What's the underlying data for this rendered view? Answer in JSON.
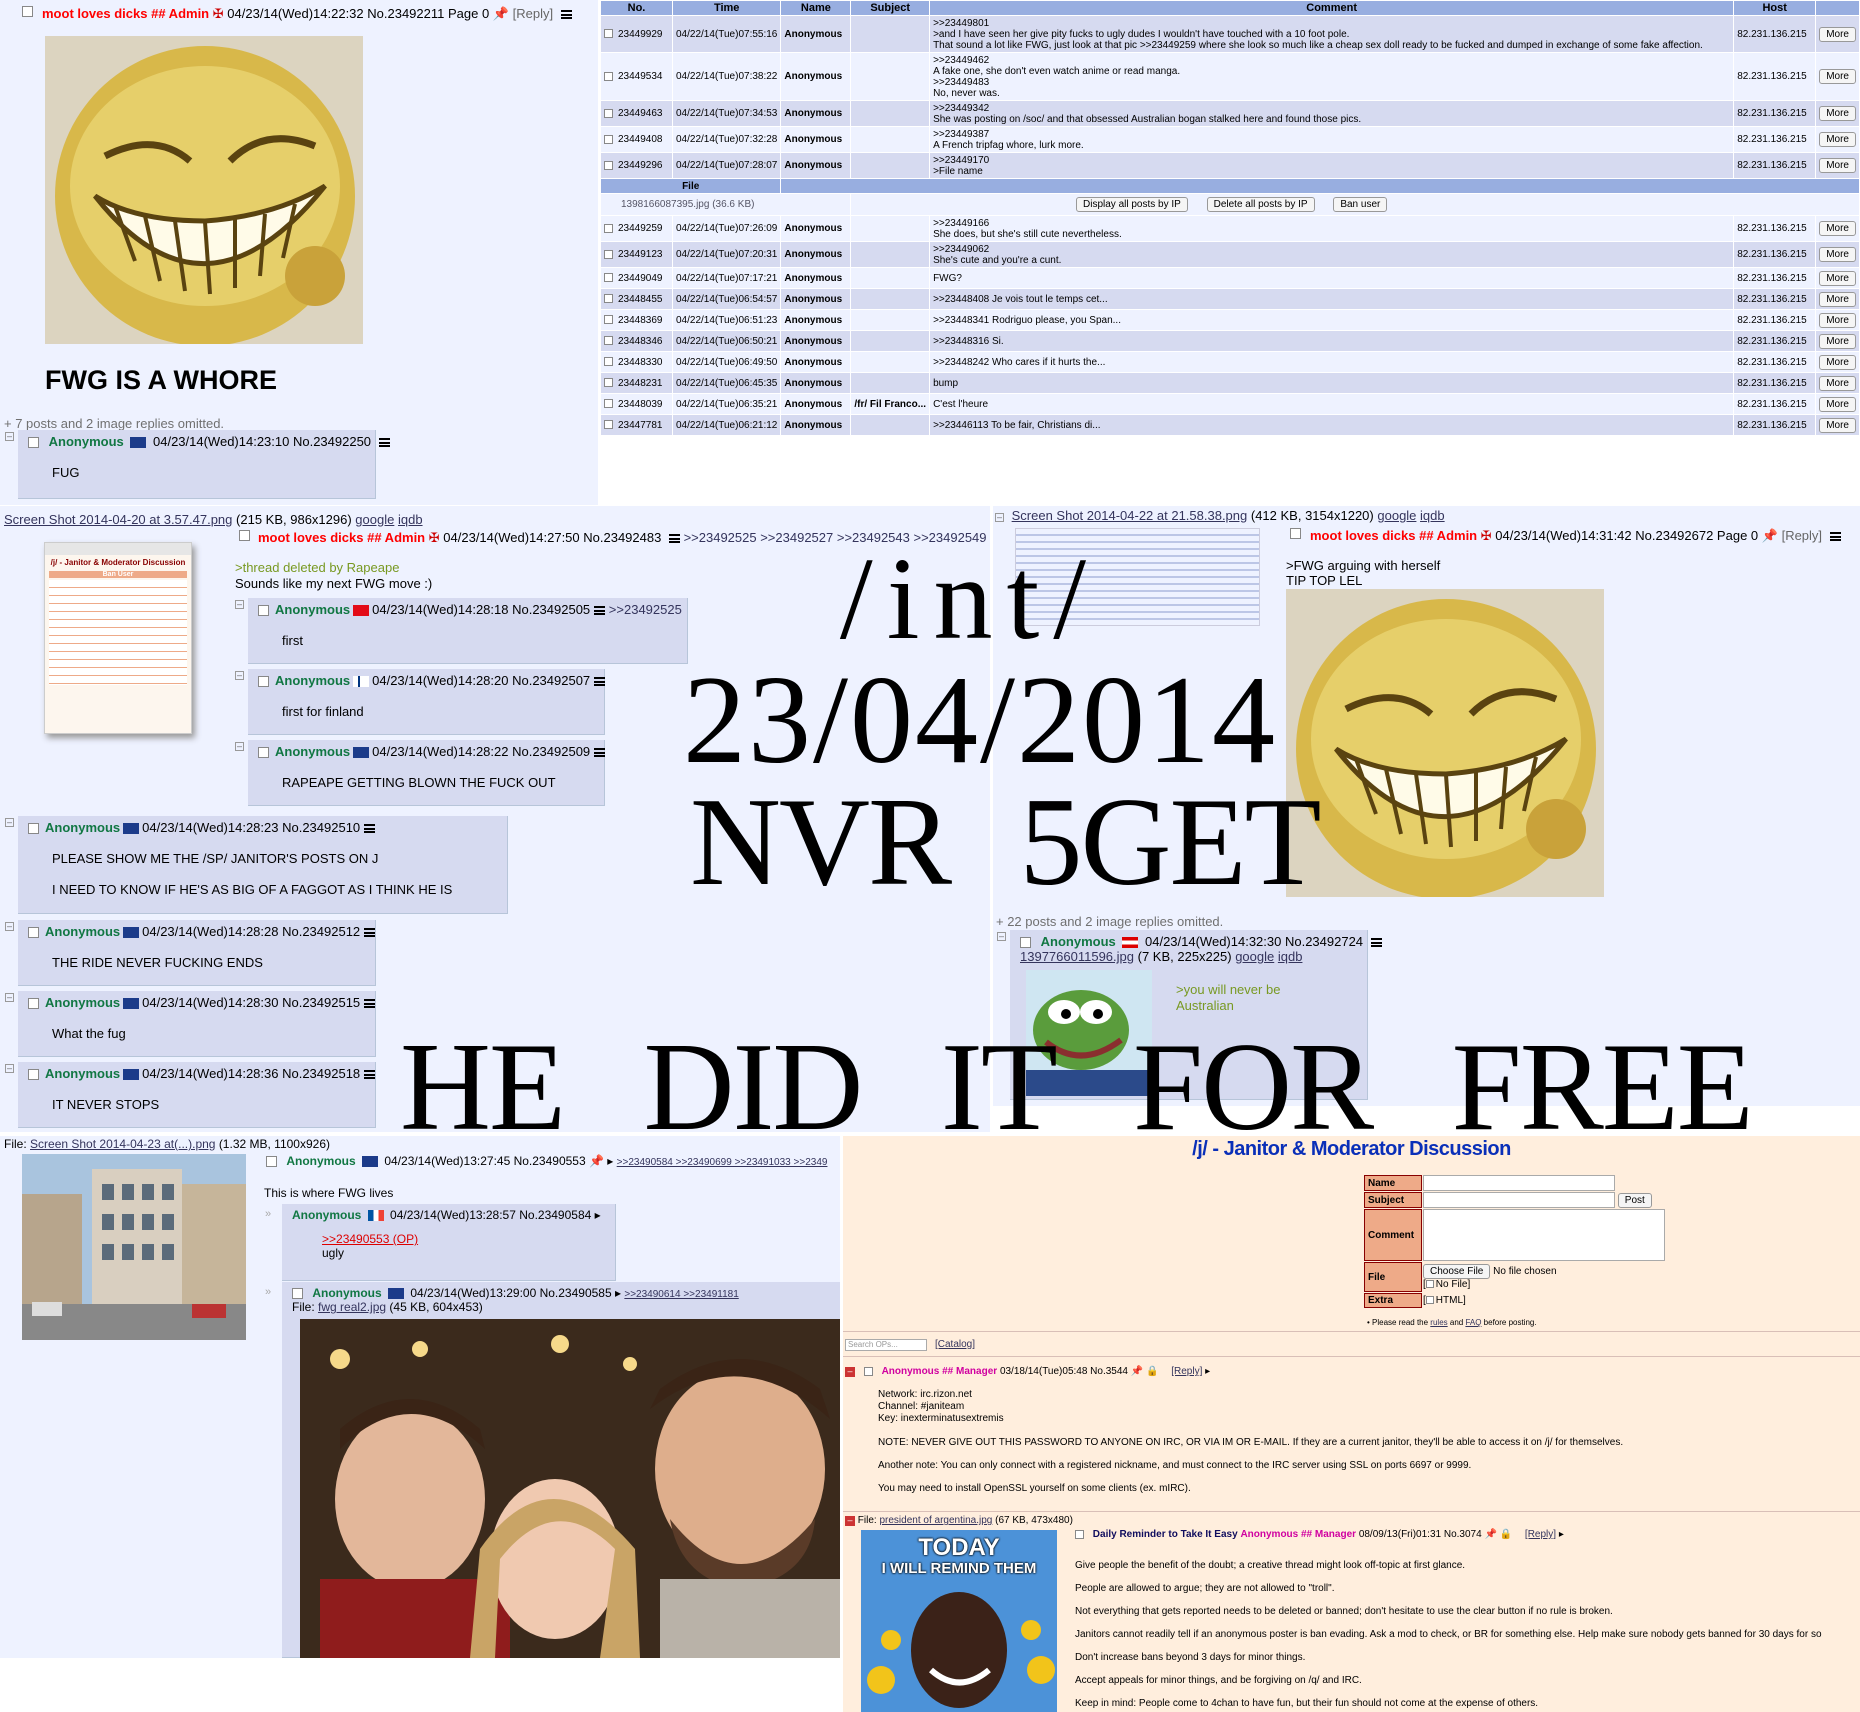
{
  "top_left": {
    "op_name": "moot loves dicks ## Admin",
    "op_meta": "04/23/14(Wed)14:22:32 No.23492211 Page 0",
    "op_reply": "[Reply]",
    "op_subject": "FWG IS A WHORE",
    "omitted": "+ 7 posts and 2 image replies omitted.",
    "reply_name": "Anonymous",
    "reply_meta": "04/23/14(Wed)14:23:10 No.23492250",
    "reply_text": "FUG"
  },
  "mod_table": {
    "headers": [
      "No.",
      "Time",
      "Name",
      "Subject",
      "Comment",
      "Host",
      ""
    ],
    "more_label": "More",
    "rows1": [
      {
        "no": "23449929",
        "time": "04/22/14(Tue)07:55:16",
        "name": "Anonymous",
        "comment": [
          ">>23449801",
          ">and I have seen her give pity fucks to ugly dudes I wouldn't have touched with a 10 foot pole.",
          "That sound a lot like FWG, just look at that pic >>23449259 where she look so much like a cheap sex doll ready to be fucked and dumped in exchange of some fake affection."
        ],
        "host": "82.231.136.215"
      },
      {
        "no": "23449534",
        "time": "04/22/14(Tue)07:38:22",
        "name": "Anonymous",
        "comment": [
          ">>23449462",
          "A fake one, she don't even watch anime or read manga.",
          ">>23449483",
          "No, never was."
        ],
        "host": "82.231.136.215"
      },
      {
        "no": "23449463",
        "time": "04/22/14(Tue)07:34:53",
        "name": "Anonymous",
        "comment": [
          ">>23449342",
          "She was posting on /soc/ and that obsessed Australian bogan stalked here and found those pics."
        ],
        "host": "82.231.136.215"
      },
      {
        "no": "23449408",
        "time": "04/22/14(Tue)07:32:28",
        "name": "Anonymous",
        "comment": [
          ">>23449387",
          "A French tripfag whore, lurk more."
        ],
        "host": "82.231.136.215"
      },
      {
        "no": "23449296",
        "time": "04/22/14(Tue)07:28:07",
        "name": "Anonymous",
        "comment": [
          ">>23449170",
          ">File name"
        ],
        "host": "82.231.136.215"
      }
    ],
    "file_header": "File",
    "file_name": "1398166087395.jpg (36.6 KB)",
    "file_buttons": [
      "Display all posts by IP",
      "Delete all posts by IP",
      "Ban user"
    ],
    "rows2": [
      {
        "no": "23449259",
        "time": "04/22/14(Tue)07:26:09",
        "name": "Anonymous",
        "comment": [
          ">>23449166",
          "She does, but she's still cute nevertheless."
        ],
        "host": "82.231.136.215"
      },
      {
        "no": "23449123",
        "time": "04/22/14(Tue)07:20:31",
        "name": "Anonymous",
        "comment": [
          ">>23449062",
          "She's cute and you're a cunt."
        ],
        "host": "82.231.136.215"
      },
      {
        "no": "23449049",
        "time": "04/22/14(Tue)07:17:21",
        "name": "Anonymous",
        "comment": [
          "FWG?"
        ],
        "host": "82.231.136.215"
      },
      {
        "no": "23448455",
        "time": "04/22/14(Tue)06:54:57",
        "name": "Anonymous",
        "comment": [
          ">>23448408 Je vois tout le temps cet..."
        ],
        "host": "82.231.136.215"
      },
      {
        "no": "23448369",
        "time": "04/22/14(Tue)06:51:23",
        "name": "Anonymous",
        "comment": [
          ">>23448341 Rodriguo please, you Span..."
        ],
        "host": "82.231.136.215"
      },
      {
        "no": "23448346",
        "time": "04/22/14(Tue)06:50:21",
        "name": "Anonymous",
        "comment": [
          ">>23448316 Si."
        ],
        "host": "82.231.136.215"
      },
      {
        "no": "23448330",
        "time": "04/22/14(Tue)06:49:50",
        "name": "Anonymous",
        "comment": [
          ">>23448242 Who cares if it hurts the..."
        ],
        "host": "82.231.136.215"
      },
      {
        "no": "23448231",
        "time": "04/22/14(Tue)06:45:35",
        "name": "Anonymous",
        "comment": [
          "bump"
        ],
        "host": "82.231.136.215"
      },
      {
        "no": "23448039",
        "time": "04/22/14(Tue)06:35:21",
        "name": "Anonymous",
        "subject": "/fr/ Fil Franco...",
        "comment": [
          "C'est l'heure"
        ],
        "host": "82.231.136.215"
      },
      {
        "no": "23447781",
        "time": "04/22/14(Tue)06:21:12",
        "name": "Anonymous",
        "comment": [
          ">>23446113 To be fair, Christians di..."
        ],
        "host": "82.231.136.215"
      }
    ]
  },
  "mid_left": {
    "file_link": "Screen Shot 2014-04-20 at 3.57.47.png",
    "file_info": "(215 KB, 986x1296)",
    "google": "google",
    "iqdb": "iqdb",
    "op_name": "moot loves dicks ## Admin",
    "op_meta": "04/23/14(Wed)14:27:50 No.23492483",
    "op_backlinks": ">>23492525 >>23492527 >>23492543 >>23492549",
    "op_green": ">thread deleted by Rapeape",
    "op_text": "Sounds like my next FWG move :)",
    "thumb_title": "/j/ - Janitor & Moderator Discussion",
    "thumb_ban": "Ban User",
    "replies": [
      {
        "name": "Anonymous",
        "meta": "04/23/14(Wed)14:28:18 No.23492505",
        "backlink": ">>23492525",
        "text": [
          "first"
        ]
      },
      {
        "name": "Anonymous",
        "meta": "04/23/14(Wed)14:28:20 No.23492507",
        "text": [
          "first for finland"
        ]
      },
      {
        "name": "Anonymous",
        "meta": "04/23/14(Wed)14:28:22 No.23492509",
        "text": [
          "RAPEAPE GETTING BLOWN THE FUCK OUT"
        ]
      },
      {
        "name": "Anonymous",
        "meta": "04/23/14(Wed)14:28:23 No.23492510",
        "text": [
          "PLEASE SHOW ME THE /SP/ JANITOR'S POSTS ON J",
          "I NEED TO KNOW IF HE'S AS BIG OF A FAGGOT AS I THINK HE IS"
        ]
      },
      {
        "name": "Anonymous",
        "meta": "04/23/14(Wed)14:28:28 No.23492512",
        "text": [
          "THE RIDE NEVER FUCKING ENDS"
        ]
      },
      {
        "name": "Anonymous",
        "meta": "04/23/14(Wed)14:28:30 No.23492515",
        "text": [
          "What the fug"
        ]
      },
      {
        "name": "Anonymous",
        "meta": "04/23/14(Wed)14:28:36 No.23492518",
        "text": [
          "IT NEVER STOPS"
        ]
      }
    ]
  },
  "overlay": {
    "line1": "/int/",
    "line2": "23/04/2014",
    "line3": "NVR 5GET",
    "bottom": "HE DID IT FOR FREE"
  },
  "mid_right": {
    "file_link": "Screen Shot 2014-04-22 at 21.58.38.png",
    "file_info": "(412 KB, 3154x1220)",
    "google": "google",
    "iqdb": "iqdb",
    "op_name": "moot loves dicks ## Admin",
    "op_meta": "04/23/14(Wed)14:31:42 No.23492672 Page 0",
    "op_reply": "[Reply]",
    "op_green": ">FWG arguing with herself",
    "op_text": "TIP TOP LEL",
    "omitted": "+ 22 posts and 2 image replies omitted.",
    "reply_name": "Anonymous",
    "reply_meta": "04/23/14(Wed)14:32:30 No.23492724",
    "reply_file": "1397766011596.jpg",
    "reply_file_info": "(7 KB, 225x225)",
    "reply_green": [
      ">you will never be",
      "Australian"
    ]
  },
  "bottom_left": {
    "file_label": "File:",
    "file_link": "Screen Shot 2014-04-23 at(...).png",
    "file_info": "(1.32 MB, 1100x926)",
    "op_name": "Anonymous",
    "op_meta": "04/23/14(Wed)13:27:45 No.23490553",
    "op_backlinks": ">>23490584 >>23490699 >>23491033 >>2349",
    "op_text": "This is where FWG lives",
    "r1_name": "Anonymous",
    "r1_meta": "04/23/14(Wed)13:28:57 No.23490584",
    "r1_quote": ">>23490553 (OP)",
    "r1_text": "ugly",
    "r2_name": "Anonymous",
    "r2_meta": "04/23/14(Wed)13:29:00 No.23490585",
    "r2_backlinks": ">>23490614 >>23491181",
    "r2_file_label": "File:",
    "r2_file": "fwg real2.jpg",
    "r2_file_info": "(45 KB, 604x453)",
    "arrow": "»",
    "arrow2": "»"
  },
  "bottom_right": {
    "title": "/j/ - Janitor & Moderator Discussion",
    "form": {
      "name": "Name",
      "subject": "Subject",
      "post": "Post",
      "comment": "Comment",
      "file": "File",
      "choose": "Choose File",
      "nofile": "No file chosen",
      "extra": "Extra",
      "no_file_opt": "No File]",
      "html_opt": "HTML]",
      "rules_pre": "• Please read the ",
      "rules": "rules",
      "and": " and ",
      "faq": "FAQ",
      "rules_post": " before posting."
    },
    "search_placeholder": "Search OPs...",
    "catalog": "[Catalog]",
    "post1_name": "Anonymous ## Manager",
    "post1_meta": "03/18/14(Tue)05:48 No.3544",
    "reply": "[Reply]",
    "post1_lines": [
      "Network: irc.rizon.net",
      "Channel: #janiteam",
      "Key: inexterminatusextremis"
    ],
    "post1_note": "NOTE: NEVER GIVE OUT THIS PASSWORD TO ANYONE ON IRC, OR VIA IM OR E-MAIL. If they are a current janitor, they'll be able to access it on /j/ for themselves.",
    "post1_note2": "Another note: You can only connect with a registered nickname, and must connect to the IRC server using SSL on ports 6697 or 9999.",
    "post1_note3": "You may need to install OpenSSL yourself on some clients (ex. mIRC).",
    "post2_file_label": "File:",
    "post2_file": "president of argentina.jpg",
    "post2_file_info": "(67 KB, 473x480)",
    "post2_subject": "Daily Reminder to Take It Easy",
    "post2_name": "Anonymous ## Manager",
    "post2_meta": "08/09/13(Fri)01:31 No.3074",
    "post2_lines": [
      "Give people the benefit of the doubt; a creative thread might look off-topic at first glance.",
      "People are allowed to argue; they are not allowed to \"troll\".",
      "Not everything that gets reported needs to be deleted or banned; don't hesitate to use the clear button if no rule is broken.",
      "Janitors cannot readily tell if an anonymous poster is ban evading. Ask a mod to check, or BR for something else. Help make sure nobody gets banned for 30 days for so",
      "Don't increase bans beyond 3 days for minor things.",
      "Accept appeals for minor things, and be forgiving on /q/ and IRC.",
      "Keep in mind: People come to 4chan to have fun, but their fun should not come at the expense of others."
    ],
    "meme_top": "TODAY",
    "meme_bottom": "I WILL REMIND THEM"
  }
}
